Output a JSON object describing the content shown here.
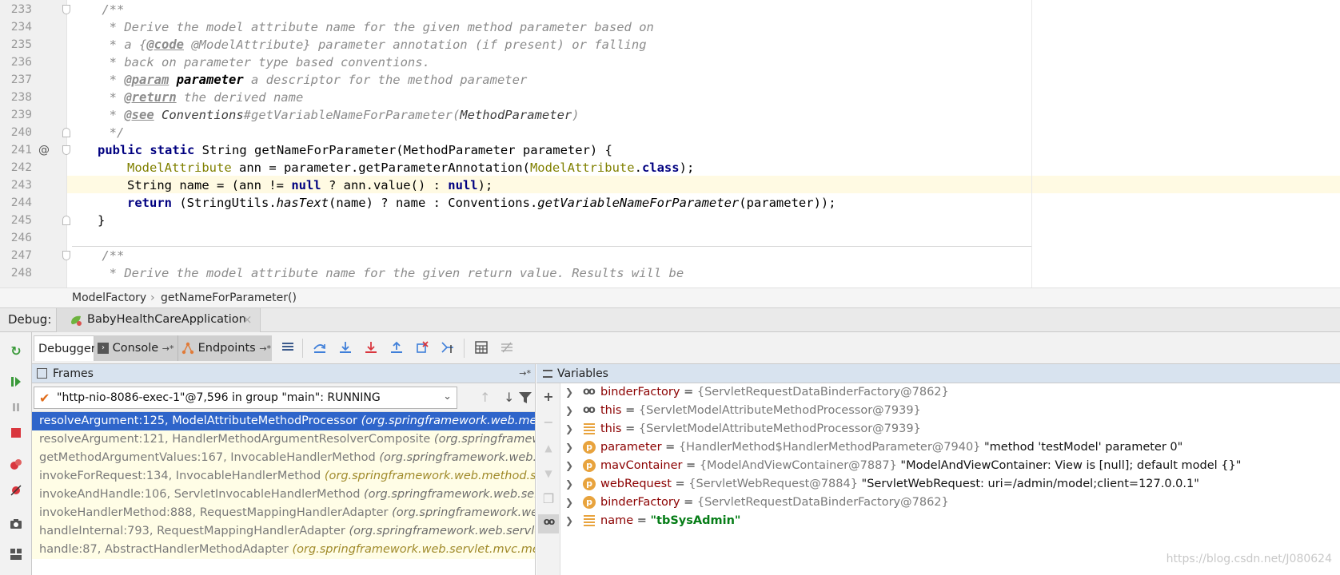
{
  "editor": {
    "line_numbers": [
      "233",
      "234",
      "235",
      "236",
      "237",
      "238",
      "239",
      "240",
      "241",
      "242",
      "243",
      "244",
      "245",
      "246",
      "247",
      "248"
    ],
    "gutter_at": "@",
    "lines": {
      "l233": "    /**",
      "l234": "     * Derive the model attribute name for the given method parameter based on",
      "l235_a": "     * a {",
      "l235_b": "@code",
      "l235_c": " @ModelAttribute} parameter annotation (if present) or falling",
      "l236": "     * back on parameter type based conventions.",
      "l237_a": "     * ",
      "l237_b": "@param",
      "l237_c": " ",
      "l237_d": "parameter",
      "l237_e": " a descriptor for the method parameter",
      "l238_a": "     * ",
      "l238_b": "@return",
      "l238_c": " the derived name",
      "l239_a": "     * ",
      "l239_b": "@see",
      "l239_c": " ",
      "l239_d": "Conventions",
      "l239_e": "#getVariableNameForParameter(",
      "l239_f": "MethodParameter",
      "l239_g": ")",
      "l240": "     */",
      "l241_a": "public static",
      "l241_b": " String getNameForParameter(MethodParameter parameter) {",
      "l242_a": "ModelAttribute",
      "l242_b": " ann = parameter.getParameterAnnotation(",
      "l242_c": "ModelAttribute",
      "l242_d": ".",
      "l242_e": "class",
      "l242_f": ");",
      "l243_a": "String name = (ann != ",
      "l243_b": "null",
      "l243_c": " ? ann.value() : ",
      "l243_d": "null",
      "l243_e": ");",
      "l244_a": "return",
      "l244_b": " (StringUtils.",
      "l244_c": "hasText",
      "l244_d": "(name) ? name : Conventions.",
      "l244_e": "getVariableNameForParameter",
      "l244_f": "(parameter));",
      "l245": "}",
      "l247": "    /**",
      "l248": "     * Derive the model attribute name for the given return value. Results will be"
    }
  },
  "breadcrumb": {
    "class_name": "ModelFactory",
    "separator": "›",
    "method_name": "getNameForParameter()"
  },
  "debug_bar": {
    "label": "Debug:",
    "run_config": "BabyHealthCareApplication",
    "close": "×"
  },
  "toolbar": {
    "tabs": {
      "debugger": "Debugger",
      "console": "Console",
      "endpoints": "Endpoints",
      "pin": "→*"
    }
  },
  "frames": {
    "title": "Frames",
    "pin": "→*",
    "thread": "\"http-nio-8086-exec-1\"@7,596 in group \"main\": RUNNING",
    "items": [
      {
        "method": "resolveArgument:125, ModelAttributeMethodProcessor",
        "pkg": "(org.springframework.web.method.annotation)"
      },
      {
        "method": "resolveArgument:121, HandlerMethodArgumentResolverComposite",
        "pkg": "(org.springframework.web.method.support)"
      },
      {
        "method": "getMethodArgumentValues:167, InvocableHandlerMethod",
        "pkg": "(org.springframework.web.method.support)"
      },
      {
        "method": "invokeForRequest:134, InvocableHandlerMethod",
        "pkg": "(org.springframework.web.method.support)"
      },
      {
        "method": "invokeAndHandle:106, ServletInvocableHandlerMethod",
        "pkg": "(org.springframework.web.servlet.mvc.method.annotation)"
      },
      {
        "method": "invokeHandlerMethod:888, RequestMappingHandlerAdapter",
        "pkg": "(org.springframework.web.servlet.mvc.method.annotation)"
      },
      {
        "method": "handleInternal:793, RequestMappingHandlerAdapter",
        "pkg": "(org.springframework.web.servlet.mvc.method.annotation)"
      },
      {
        "method": "handle:87, AbstractHandlerMethodAdapter",
        "pkg": "(org.springframework.web.servlet.mvc.method)"
      }
    ]
  },
  "variables": {
    "title": "Variables",
    "items": [
      {
        "icon": "watch-icon",
        "name": "binderFactory",
        "eq": " = ",
        "type": "{ServletRequestDataBinderFactory@7862}",
        "value": ""
      },
      {
        "icon": "watch-icon",
        "name": "this",
        "eq": " = ",
        "type": "{ServletModelAttributeMethodProcessor@7939}",
        "value": ""
      },
      {
        "icon": "field-icon",
        "name": "this",
        "eq": " = ",
        "type": "{ServletModelAttributeMethodProcessor@7939}",
        "value": ""
      },
      {
        "icon": "parameter-icon",
        "name": "parameter",
        "eq": " = ",
        "type": "{HandlerMethod$HandlerMethodParameter@7940}",
        "value": " \"method 'testModel' parameter 0\""
      },
      {
        "icon": "parameter-icon",
        "name": "mavContainer",
        "eq": " = ",
        "type": "{ModelAndViewContainer@7887}",
        "value": " \"ModelAndViewContainer: View is [null]; default model {}\""
      },
      {
        "icon": "parameter-icon",
        "name": "webRequest",
        "eq": " = ",
        "type": "{ServletWebRequest@7884}",
        "value": " \"ServletWebRequest: uri=/admin/model;client=127.0.0.1\""
      },
      {
        "icon": "parameter-icon",
        "name": "binderFactory",
        "eq": " = ",
        "type": "{ServletRequestDataBinderFactory@7862}",
        "value": ""
      },
      {
        "icon": "field-icon",
        "name": "name",
        "eq": " = ",
        "type": "",
        "value": "\"tbSysAdmin\""
      }
    ],
    "badge_p": "p",
    "badge_oo": "oo"
  },
  "watermark": "https://blog.csdn.net/J080624",
  "colors": {
    "accent": "#2f65ca",
    "frame_bg": "#fffde6",
    "header_bg": "#d8e3ef",
    "string_green": "#067d17",
    "var_name": "#8b0000"
  }
}
